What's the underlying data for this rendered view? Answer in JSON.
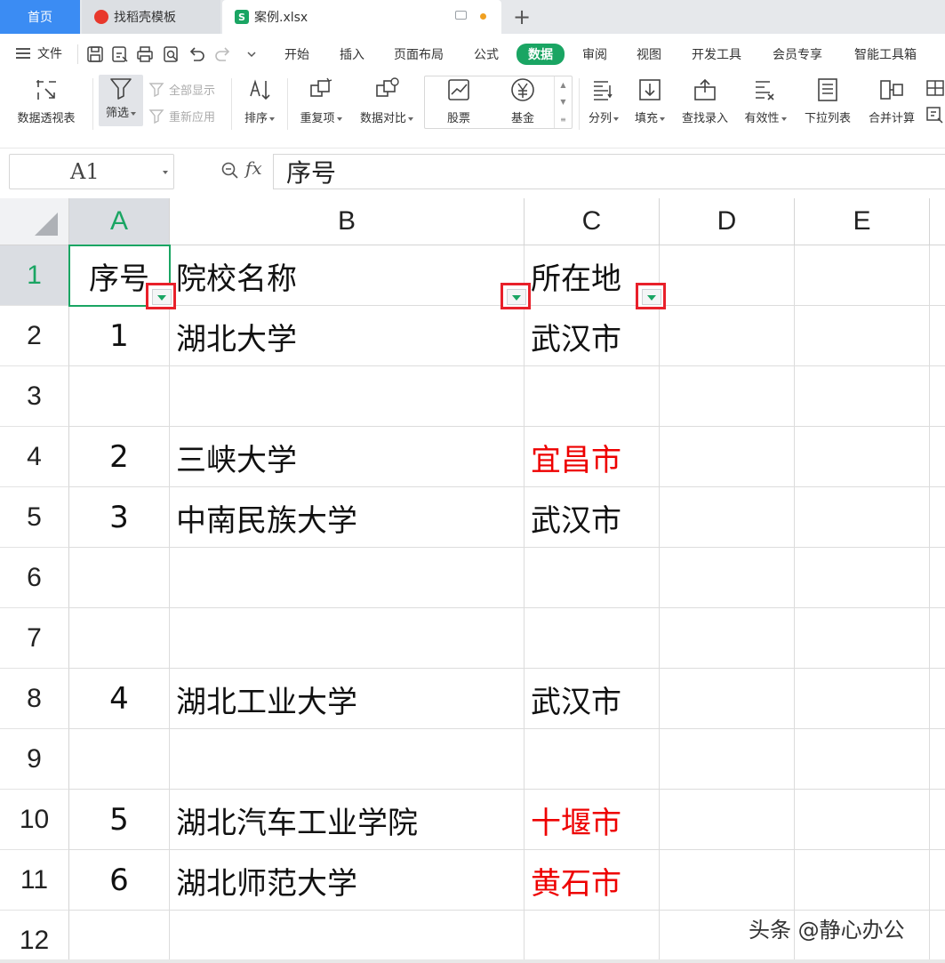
{
  "tabs": {
    "home": "首页",
    "template": "找稻壳模板",
    "file": "案例.xlsx",
    "file_logo": "S"
  },
  "menubar": {
    "file_label": "文件",
    "items": [
      "开始",
      "插入",
      "页面布局",
      "公式",
      "数据",
      "审阅",
      "视图",
      "开发工具",
      "会员专享",
      "智能工具箱"
    ],
    "active": "数据"
  },
  "ribbon": {
    "pivot": "数据透视表",
    "filter": "筛选",
    "show_all": "全部显示",
    "reapply": "重新应用",
    "sort": "排序",
    "duplicates": "重复项",
    "compare": "数据对比",
    "stock": "股票",
    "fund": "基金",
    "split": "分列",
    "fill": "填充",
    "lookup": "查找录入",
    "validity": "有效性",
    "dropdown": "下拉列表",
    "merge_calc": "合并计算"
  },
  "formula": {
    "cell_ref": "A1",
    "fx": "fx",
    "value": "序号"
  },
  "columns": [
    "A",
    "B",
    "C",
    "D",
    "E"
  ],
  "rows": [
    "1",
    "2",
    "3",
    "4",
    "5",
    "6",
    "7",
    "8",
    "9",
    "10",
    "11",
    "12"
  ],
  "cells": {
    "r1": {
      "a": "序号",
      "b": "院校名称",
      "c": "所在地"
    },
    "r2": {
      "a": "1",
      "b": "湖北大学",
      "c": "武汉市"
    },
    "r4": {
      "a": "2",
      "b": "三峡大学",
      "c": "宜昌市"
    },
    "r5": {
      "a": "3",
      "b": "中南民族大学",
      "c": "武汉市"
    },
    "r8": {
      "a": "4",
      "b": "湖北工业大学",
      "c": "武汉市"
    },
    "r10": {
      "a": "5",
      "b": "湖北汽车工业学院",
      "c": "十堰市"
    },
    "r11": {
      "a": "6",
      "b": "湖北师范大学",
      "c": "黄石市"
    }
  },
  "colors": {
    "accent_green": "#1aa563",
    "highlight_red": "#ee0000",
    "home_tab_blue": "#3b8cf3"
  },
  "watermark": "头条 @静心办公"
}
